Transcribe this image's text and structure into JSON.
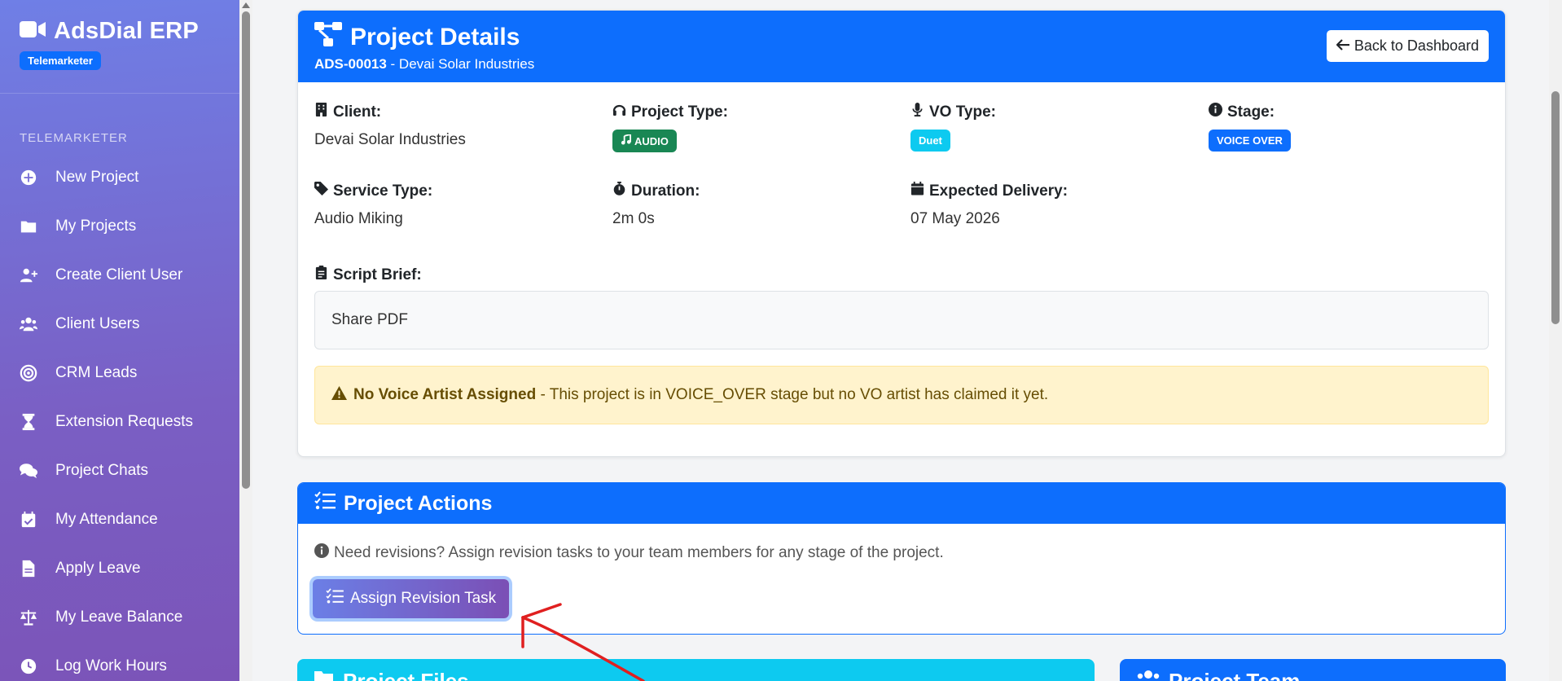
{
  "sidebar": {
    "brand": "AdsDial ERP",
    "role_badge": "Telemarketer",
    "section_label": "TELEMARKETER",
    "items": [
      {
        "label": "New Project",
        "icon": "plus-circle-icon"
      },
      {
        "label": "My Projects",
        "icon": "folder-icon"
      },
      {
        "label": "Create Client User",
        "icon": "user-plus-icon"
      },
      {
        "label": "Client Users",
        "icon": "users-icon"
      },
      {
        "label": "CRM Leads",
        "icon": "bullseye-icon"
      },
      {
        "label": "Extension Requests",
        "icon": "hourglass-icon"
      },
      {
        "label": "Project Chats",
        "icon": "comments-icon"
      },
      {
        "label": "My Attendance",
        "icon": "calendar-check-icon"
      },
      {
        "label": "Apply Leave",
        "icon": "file-icon"
      },
      {
        "label": "My Leave Balance",
        "icon": "balance-scale-icon"
      },
      {
        "label": "Log Work Hours",
        "icon": "clock-icon"
      }
    ]
  },
  "project_details": {
    "title": "Project Details",
    "project_id": "ADS-00013",
    "project_name_suffix": " - Devai Solar Industries",
    "back_button": "Back to Dashboard",
    "client_label": "Client:",
    "client_value": "Devai Solar Industries",
    "project_type_label": "Project Type:",
    "project_type_badge": "AUDIO",
    "vo_type_label": "VO Type:",
    "vo_type_badge": "Duet",
    "stage_label": "Stage:",
    "stage_badge": "VOICE OVER",
    "service_type_label": "Service Type:",
    "service_type_value": "Audio Miking",
    "duration_label": "Duration:",
    "duration_value": "2m 0s",
    "expected_delivery_label": "Expected Delivery:",
    "expected_delivery_value": "07 May 2026",
    "script_brief_label": "Script Brief:",
    "script_brief_value": "Share PDF",
    "alert_title": "No Voice Artist Assigned",
    "alert_text": " - This project is in VOICE_OVER stage but no VO artist has claimed it yet."
  },
  "project_actions": {
    "title": "Project Actions",
    "info": "Need revisions? Assign revision tasks to your team members for any stage of the project.",
    "assign_button": "Assign Revision Task"
  },
  "project_files": {
    "title": "Project Files"
  },
  "project_team": {
    "title": "Project Team"
  },
  "colors": {
    "primary": "#0d6efd",
    "info": "#0dcaf0",
    "success": "#198754",
    "warning_bg": "#fff3cd",
    "annotation": "#e02020"
  }
}
